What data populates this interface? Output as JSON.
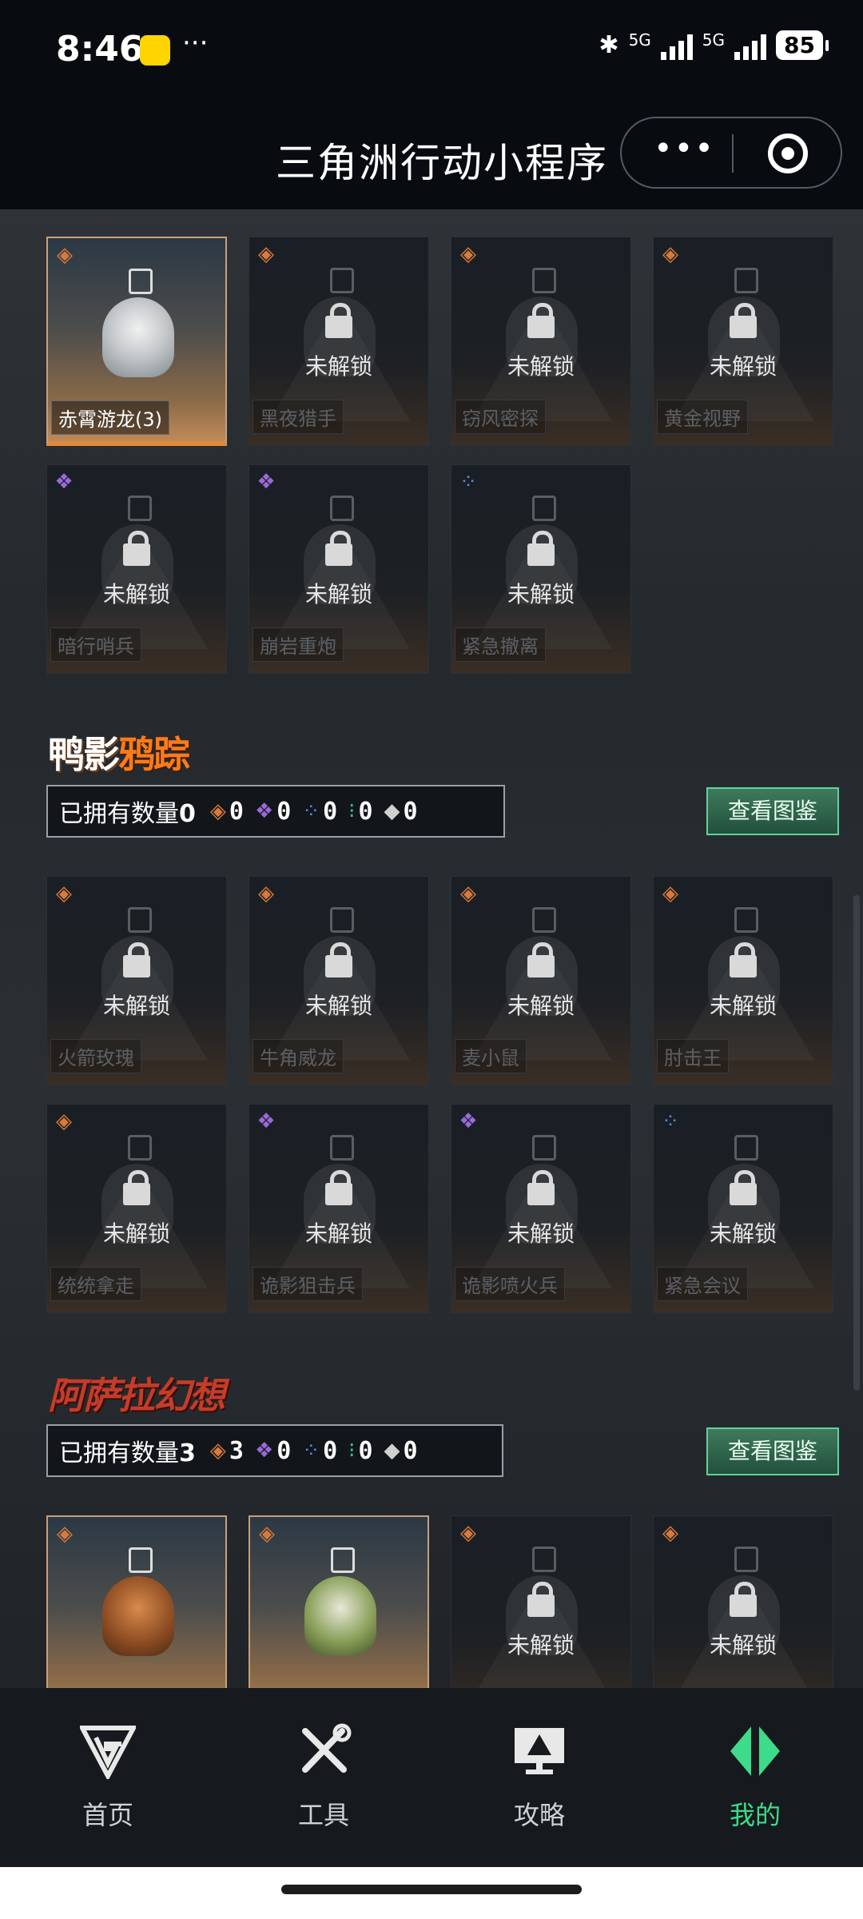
{
  "status_bar": {
    "time": "8:46",
    "notif_icon": "app-notification-icon",
    "more": "···",
    "network": "5G",
    "battery": "85"
  },
  "nav": {
    "title": "三角洲行动小程序",
    "more": "•••"
  },
  "colors": {
    "accent": "#3ddc8a",
    "owned_border": "#e08a3a",
    "rarity_orange": "#d87a3a",
    "rarity_purple": "#9a6ad8",
    "rarity_blue": "#5a8ad8",
    "rarity_green": "#3ac08a",
    "rarity_white": "#d0d0d0"
  },
  "top_cards": [
    {
      "name": "赤霄游龙(3)",
      "owned": true,
      "rarity": "orange"
    },
    {
      "name": "黑夜猎手",
      "owned": false,
      "rarity": "orange"
    },
    {
      "name": "窃风密探",
      "owned": false,
      "rarity": "orange"
    },
    {
      "name": "黄金视野",
      "owned": false,
      "rarity": "orange"
    },
    {
      "name": "暗行哨兵",
      "owned": false,
      "rarity": "purple"
    },
    {
      "name": "崩岩重炮",
      "owned": false,
      "rarity": "purple"
    },
    {
      "name": "紧急撤离",
      "owned": false,
      "rarity": "blue"
    }
  ],
  "locked_text": "未解锁",
  "section_duck": {
    "logo_a": "鸭影",
    "logo_b": "鸦踪",
    "count_label": "已拥有数量",
    "count": "0",
    "gems": [
      "0",
      "0",
      "0",
      "0",
      "0"
    ],
    "view_button": "查看图鉴",
    "cards": [
      {
        "name": "火箭玫瑰",
        "rarity": "orange"
      },
      {
        "name": "牛角威龙",
        "rarity": "orange"
      },
      {
        "name": "麦小鼠",
        "rarity": "orange"
      },
      {
        "name": "肘击王",
        "rarity": "orange"
      },
      {
        "name": "统统拿走",
        "rarity": "orange"
      },
      {
        "name": "诡影狙击兵",
        "rarity": "purple"
      },
      {
        "name": "诡影喷火兵",
        "rarity": "purple"
      },
      {
        "name": "紧急会议",
        "rarity": "blue"
      }
    ]
  },
  "section_arab": {
    "logo": "阿萨拉幻想",
    "count_label": "已拥有数量",
    "count": "3",
    "gems": [
      "3",
      "0",
      "0",
      "0",
      "0"
    ],
    "view_button": "查看图鉴"
  },
  "tabs": [
    {
      "label": "首页",
      "icon": "delta-logo-icon"
    },
    {
      "label": "工具",
      "icon": "tools-icon"
    },
    {
      "label": "攻略",
      "icon": "guide-monitor-icon"
    },
    {
      "label": "我的",
      "icon": "profile-diamond-icon",
      "active": true
    }
  ]
}
